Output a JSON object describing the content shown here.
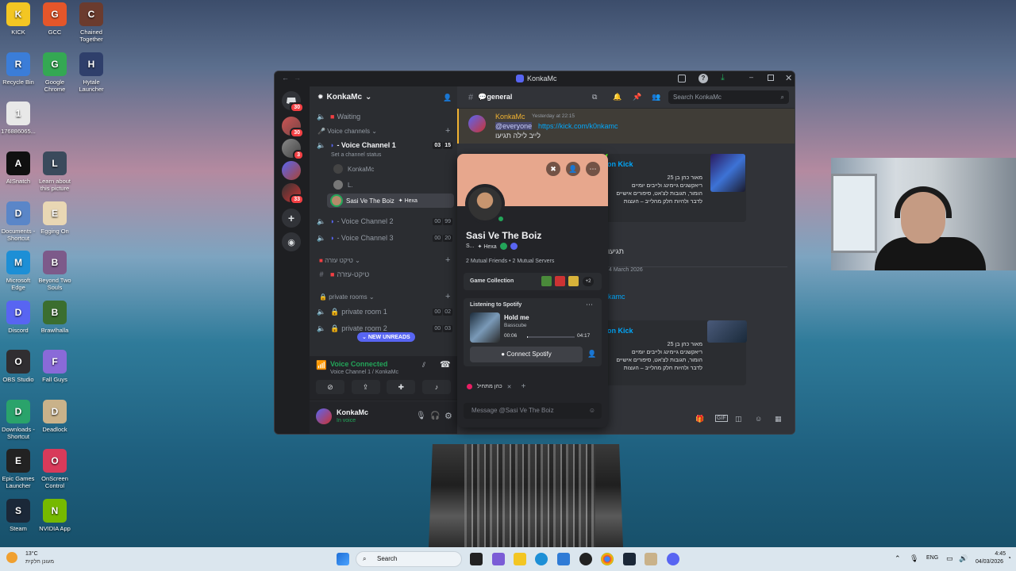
{
  "desktop": {
    "icons": [
      {
        "label": "KICK",
        "color": "#f3c623"
      },
      {
        "label": "GCC",
        "color": "#e5562a"
      },
      {
        "label": "Chained Together",
        "color": "#6b3b2e"
      },
      {
        "label": "Recycle Bin",
        "color": "#3b7dd8"
      },
      {
        "label": "Google Chrome",
        "color": "#34a853"
      },
      {
        "label": "Hytale Launcher",
        "color": "#2f3f6b"
      },
      {
        "label": "176886065...",
        "color": "#e8e8e8"
      },
      {
        "label": "AISnatch",
        "color": "#101010"
      },
      {
        "label": "Learn about this picture",
        "color": "#3a4a5c"
      },
      {
        "label": "Documents - Shortcut",
        "color": "#5a86c8"
      },
      {
        "label": "Egging On",
        "color": "#e9d7b4"
      },
      {
        "label": "Microsoft Edge",
        "color": "#1d8fd6"
      },
      {
        "label": "Beyond Two Souls",
        "color": "#7d5a8a"
      },
      {
        "label": "Discord",
        "color": "#5865f2"
      },
      {
        "label": "Brawlhalla",
        "color": "#3b6e2f"
      },
      {
        "label": "OBS Studio",
        "color": "#302e31"
      },
      {
        "label": "Fall Guys",
        "color": "#8a6ad8"
      },
      {
        "label": "Downloads - Shortcut",
        "color": "#2aa36b"
      },
      {
        "label": "Deadlock",
        "color": "#c9b28a"
      },
      {
        "label": "Epic Games Launcher",
        "color": "#222222"
      },
      {
        "label": "OnScreen Control",
        "color": "#d83a5a"
      },
      {
        "label": "Steam",
        "color": "#1b2838"
      },
      {
        "label": "NVIDIA App",
        "color": "#76b900"
      }
    ]
  },
  "window": {
    "title": "KonkaMc",
    "server_name": "KonkaMc",
    "guild_badges": [
      "30",
      "3",
      "33"
    ],
    "channels": {
      "waiting": "Waiting",
      "voice_category": "Voice channels",
      "vc1": "- Voice Channel 1",
      "vc1_counts": [
        "03",
        "15"
      ],
      "vc1_status": "Set a channel status",
      "member1": "KonkaMc",
      "member2": "L.",
      "member3": "Sasi Ve The Boiz",
      "member3_tag": "Hexa",
      "vc2": "- Voice Channel 2",
      "vc2_counts": [
        "00",
        "99"
      ],
      "vc3": "- Voice Channel 3",
      "vc3_counts": [
        "00",
        "20"
      ],
      "ticket_category": "טיקט עזרה",
      "ticket_channel": "טיקט-עזרה",
      "private_category": "private rooms",
      "pr1": "private room 1",
      "pr1_counts": [
        "00",
        "02"
      ],
      "pr2": "private room 2",
      "pr2_counts": [
        "00",
        "03"
      ],
      "new_unreads": "NEW UNREADS"
    },
    "voice": {
      "status": "Voice Connected",
      "location": "Voice Channel 1 / KonkaMc"
    },
    "user": {
      "name": "KonkaMc",
      "status": "In voice"
    },
    "channel_header": {
      "name": "general",
      "search_placeholder": "Search KonkaMc"
    },
    "messages": {
      "author": "KonkaMc",
      "timestamp": "Yesterday at 22:15",
      "mention": "@everyone",
      "link": "https://kick.com/k0nkamc",
      "text": "לייב לילה תגיעו",
      "embed_title": "on Kick",
      "embed_desc": "מאור כהן בן 25\nריאקשנים גיימינג ולייבים יומיים\nהומור, תגובות לצ'אט, סיפורים אישיים\nלדבר ולהיות חלק מהלייב – העצות",
      "divider1": "תגיעו",
      "date": "4 March 2026",
      "author2": "kamc",
      "embed2_title": "on Kick",
      "embed2_desc": "מאור כהן בן 25\nריאקשנים גיימינג ולייבים יומיים\nהומור, תגובות לצ'אט, סיפורים אישיים\nלדבר ולהיות חלק מהלייב – העצות"
    },
    "profile": {
      "name": "Sasi Ve The Boiz",
      "tag_short": "S...",
      "tag": "Hexa",
      "mutuals": "2 Mutual Friends • 2 Mutual Servers",
      "game_collection": "Game Collection",
      "game_more": "+2",
      "listening": "Listening to Spotify",
      "song": "Hold me",
      "artist": "Basscube",
      "elapsed": "00:06",
      "duration": "04:17",
      "progress": 0.02,
      "connect": "Connect Spotify",
      "role": "כהן מתחיל",
      "message_placeholder": "Message @Sasi Ve The Boiz"
    }
  },
  "taskbar": {
    "weather_temp": "13°C",
    "weather_desc": "מעונן חלקית",
    "search": "Search",
    "lang": "ENG",
    "time": "4:45",
    "date": "04/03/2026"
  },
  "colors": {
    "accent": "#5865f2",
    "green": "#23a559",
    "red": "#f23f43",
    "link": "#00a8fc",
    "profile_banner": "#e7a78d"
  }
}
